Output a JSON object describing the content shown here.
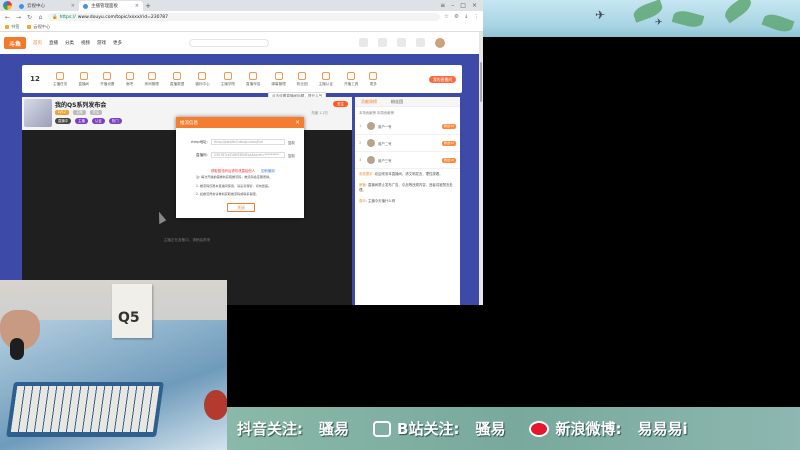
{
  "browser": {
    "tabs": [
      {
        "label": "云视中心",
        "active": false
      },
      {
        "label": "主播管理面板",
        "active": true
      }
    ],
    "url_scheme": "https://",
    "url_rest": "www.douyu.com/topic/xxxx/rid=230787",
    "bookmarks": [
      "书签",
      "云视中心"
    ]
  },
  "site": {
    "logo": "斗鱼",
    "nav": [
      "首页",
      "直播",
      "分类",
      "视频",
      "游戏",
      "更多"
    ]
  },
  "subnav": {
    "level": "12",
    "items": [
      "主播任务",
      "直播间",
      "开播设置",
      "鱼吧",
      "房间管理",
      "直播数据",
      "福利中心",
      "主播学院",
      "直播伴侣",
      "弹幕管理",
      "粉丝团",
      "主播认证",
      "开播工具",
      "更多"
    ],
    "pill": "我的直播间"
  },
  "tooltip": "点击设置直播间标题，提升人气",
  "room": {
    "title": "我的QS系列发布会",
    "meta": [
      "LV12",
      "主播",
      "关注"
    ],
    "tags": [
      "直播中",
      "主播",
      "认证",
      "热门"
    ],
    "follow": "关注",
    "stats": "热度 1.2万",
    "video_hint": "主播正在准备中，请稍后再来"
  },
  "side": {
    "tabs": [
      "贡献周榜",
      "粉丝团"
    ],
    "sub": "本场贡献榜  本周贡献榜",
    "ranks": [
      {
        "num": "1",
        "name": "用户一号",
        "badge": "粉丝15"
      },
      {
        "num": "2",
        "name": "用户二号",
        "badge": "粉丝12"
      },
      {
        "num": "3",
        "name": "用户三号",
        "badge": "粉丝10"
      }
    ],
    "chat": [
      {
        "nick": "系统提示:",
        "text": "欢迎来到本直播间，请文明发言，理性观看。"
      },
      {
        "nick": "房管:",
        "text": "直播间禁止发布广告、引战等违规内容，违者将被禁言处理。"
      },
      {
        "nick": "观众:",
        "text": "主播今天播什么呀"
      }
    ]
  },
  "modal": {
    "title": "推流信息",
    "rows": [
      {
        "label": "rtmp地址:",
        "value": "rtmp://sendtc3.douyu.com/live",
        "copy": "复制"
      },
      {
        "label": "直播码:",
        "value": "230787rXZ4HfZ85d?wsSecret=*********",
        "copy": "复制"
      }
    ],
    "red": "获取推流码后请勿泄露给他人",
    "blue": "如何使用",
    "notes": [
      "注: 每次开播前需重新获取推流码，推流码会定期更换。",
      "1. 推流码仅限本直播间使用，请妥善保管，切勿泄露。",
      "2. 如推流异常请重新获取推流码或联系客服。"
    ],
    "button": "关闭"
  },
  "overlay": {
    "douyin_label": "抖音关注:",
    "douyin_value": "骚易",
    "bili_label": "B站关注:",
    "bili_value": "骚易",
    "weibo_label": "新浪微博:",
    "weibo_value": "易易易i"
  },
  "webcam": {
    "box_text": "Q5"
  },
  "colors": {
    "accent": "#f57d2f",
    "page_bg": "#3d4aa8",
    "overlay_bar": "#78a99c"
  }
}
